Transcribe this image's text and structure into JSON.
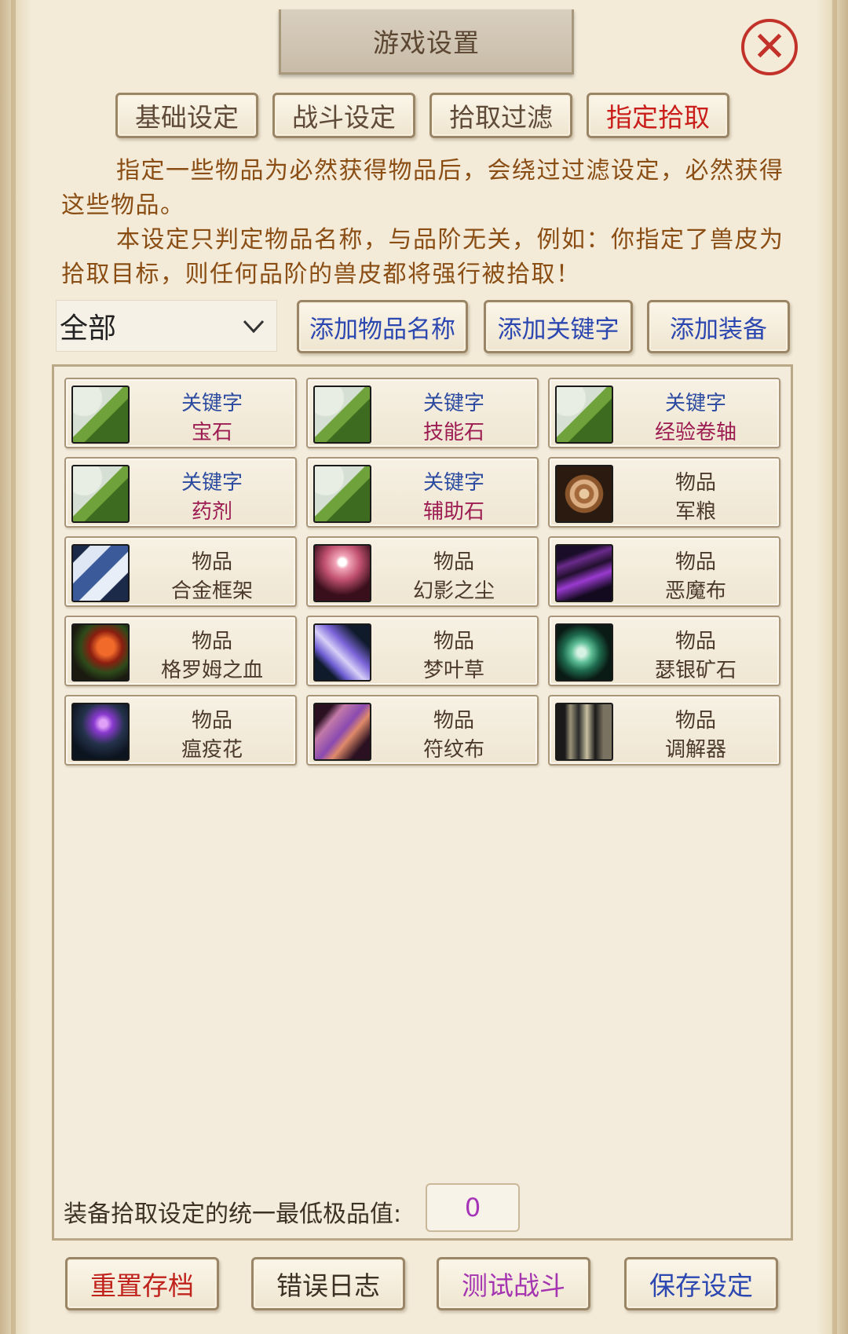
{
  "window": {
    "title": "游戏设置"
  },
  "tabs": [
    {
      "label": "基础设定",
      "active": false
    },
    {
      "label": "战斗设定",
      "active": false
    },
    {
      "label": "拾取过滤",
      "active": false
    },
    {
      "label": "指定拾取",
      "active": true
    }
  ],
  "description": {
    "paragraph1": "指定一些物品为必然获得物品后，会绕过过滤设定，必然获得这些物品。",
    "paragraph2": "本设定只判定物品名称，与品阶无关，例如：你指定了兽皮为拾取目标，则任何品阶的兽皮都将强行被拾取！"
  },
  "filter": {
    "selected": "全部"
  },
  "add_buttons": {
    "item_name": "添加物品名称",
    "keyword": "添加关键字",
    "equipment": "添加装备"
  },
  "items": [
    {
      "type": "关键字",
      "name": "宝石",
      "icon": "scroll-icon"
    },
    {
      "type": "关键字",
      "name": "技能石",
      "icon": "scroll-icon"
    },
    {
      "type": "关键字",
      "name": "经验卷轴",
      "icon": "scroll-icon"
    },
    {
      "type": "关键字",
      "name": "药剂",
      "icon": "scroll-icon"
    },
    {
      "type": "关键字",
      "name": "辅助石",
      "icon": "scroll-icon"
    },
    {
      "type": "物品",
      "name": "军粮",
      "icon": "bread-roll-icon"
    },
    {
      "type": "物品",
      "name": "合金框架",
      "icon": "metal-frame-icon"
    },
    {
      "type": "物品",
      "name": "幻影之尘",
      "icon": "phantom-dust-icon"
    },
    {
      "type": "物品",
      "name": "恶魔布",
      "icon": "demon-cloth-icon"
    },
    {
      "type": "物品",
      "name": "格罗姆之血",
      "icon": "red-herb-icon"
    },
    {
      "type": "物品",
      "name": "梦叶草",
      "icon": "purple-leaf-icon"
    },
    {
      "type": "物品",
      "name": "瑟银矿石",
      "icon": "green-ore-icon"
    },
    {
      "type": "物品",
      "name": "瘟疫花",
      "icon": "purple-flower-icon"
    },
    {
      "type": "物品",
      "name": "符纹布",
      "icon": "rune-cloth-icon"
    },
    {
      "type": "物品",
      "name": "调解器",
      "icon": "mechanism-icon"
    }
  ],
  "min_quality": {
    "label": "装备拾取设定的统一最低极品值:",
    "value": "0"
  },
  "bottom_buttons": {
    "reset": "重置存档",
    "error_log": "错误日志",
    "test_battle": "测试战斗",
    "save": "保存设定"
  },
  "colors": {
    "active_tab": "#c91e1a",
    "keyword_type": "#2b4aa0",
    "keyword_name": "#9c1c52",
    "description": "#8a4d14",
    "add_button": "#2c47b0",
    "reset_button": "#c0221c",
    "error_button": "#3d3024",
    "test_button": "#a434b0",
    "save_button": "#2c47b0"
  }
}
